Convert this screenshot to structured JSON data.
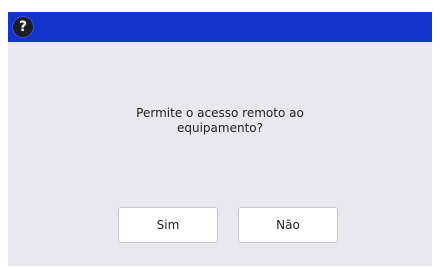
{
  "header": {
    "help_icon": "question-mark-icon",
    "help_glyph": "?",
    "accent_color": "#1433c8"
  },
  "dialog": {
    "message_line1": "Permite o acesso remoto ao",
    "message_line2": "equipamento?",
    "yes_label": "Sim",
    "no_label": "Não"
  }
}
